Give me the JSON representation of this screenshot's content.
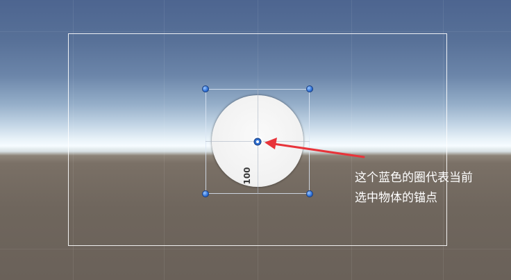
{
  "scene": {
    "knob_value": "100",
    "annotation_text": "这个蓝色的圈代表当前\n选中物体的锚点",
    "annotation_color": "#e8343a",
    "handle_color": "#2d6fd6",
    "canvas_border_color": "#ffffff"
  },
  "icons": {
    "pivot": "pivot-circle-icon",
    "resize_handle": "resize-handle-icon"
  }
}
